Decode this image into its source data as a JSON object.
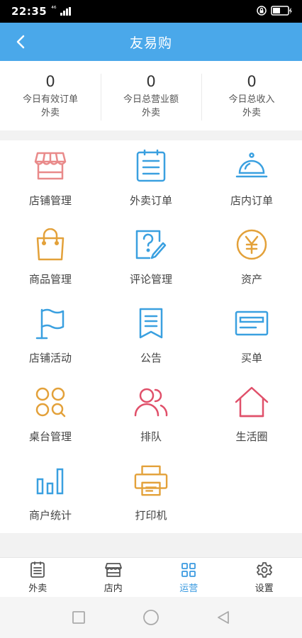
{
  "status_bar": {
    "time": "22:35",
    "network": "⁴⁶"
  },
  "header": {
    "title": "友易购"
  },
  "stats": [
    {
      "value": "0",
      "label": "今日有效订单",
      "sub": "外卖"
    },
    {
      "value": "0",
      "label": "今日总营业额",
      "sub": "外卖"
    },
    {
      "value": "0",
      "label": "今日总收入",
      "sub": "外卖"
    }
  ],
  "grid": [
    {
      "label": "店铺管理",
      "icon": "store-icon",
      "color": "#e98a8a"
    },
    {
      "label": "外卖订单",
      "icon": "clipboard-icon",
      "color": "#3aa0e0"
    },
    {
      "label": "店内订单",
      "icon": "service-bell-icon",
      "color": "#3aa0e0"
    },
    {
      "label": "商品管理",
      "icon": "shopping-bag-icon",
      "color": "#e3a13a"
    },
    {
      "label": "评论管理",
      "icon": "question-edit-icon",
      "color": "#3aa0e0"
    },
    {
      "label": "资产",
      "icon": "yen-coin-icon",
      "color": "#e3a13a"
    },
    {
      "label": "店铺活动",
      "icon": "flag-icon",
      "color": "#3aa0e0"
    },
    {
      "label": "公告",
      "icon": "notice-icon",
      "color": "#3aa0e0"
    },
    {
      "label": "买单",
      "icon": "card-icon",
      "color": "#3aa0e0"
    },
    {
      "label": "桌台管理",
      "icon": "tables-icon",
      "color": "#e3a13a"
    },
    {
      "label": "排队",
      "icon": "users-icon",
      "color": "#e0506a"
    },
    {
      "label": "生活圈",
      "icon": "home-icon",
      "color": "#e0506a"
    },
    {
      "label": "商户统计",
      "icon": "bar-chart-icon",
      "color": "#3aa0e0"
    },
    {
      "label": "打印机",
      "icon": "printer-icon",
      "color": "#e3a13a"
    }
  ],
  "tabs": [
    {
      "label": "外卖",
      "icon": "clipboard-icon",
      "active": false
    },
    {
      "label": "店内",
      "icon": "store-icon",
      "active": false
    },
    {
      "label": "运营",
      "icon": "grid-icon",
      "active": true
    },
    {
      "label": "设置",
      "icon": "gear-icon",
      "active": false
    }
  ],
  "colors": {
    "header": "#4aa8ea",
    "active_tab": "#3a9ae0"
  }
}
